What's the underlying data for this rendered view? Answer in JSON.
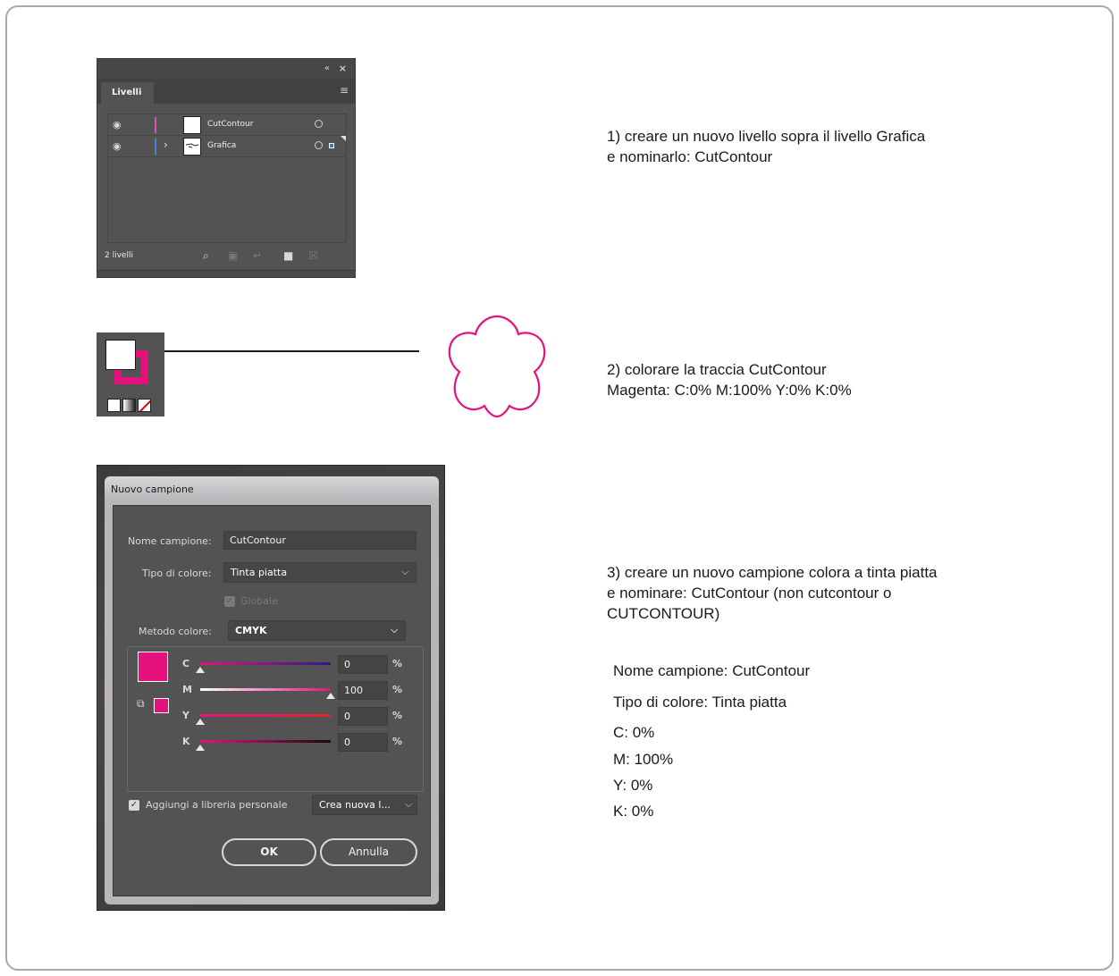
{
  "layers_panel": {
    "collapse_glyph": "«",
    "close_glyph": "×",
    "tab_label": "Livelli",
    "menu_glyph": "≡",
    "layers": [
      {
        "name": "CutContour",
        "color": "#d94fbf",
        "has_children": false,
        "selected": false
      },
      {
        "name": "Grafica",
        "color": "#4a7fd8",
        "has_children": true,
        "selected": true
      }
    ],
    "footer_count": "2 livelli",
    "footer_icons": [
      "search-icon",
      "clip-mask-icon",
      "new-sublayer-icon",
      "new-layer-icon",
      "delete-icon"
    ]
  },
  "fill_stroke": {
    "fill_color": "#ffffff",
    "stroke_color": "#e5127d",
    "modes": [
      "color",
      "gradient",
      "none"
    ]
  },
  "cut_shape": {
    "color": "#e5127d"
  },
  "dialog": {
    "title": "Nuovo campione",
    "name_label": "Nome campione:",
    "name_value": "CutContour",
    "type_label": "Tipo di colore:",
    "type_value": "Tinta piatta",
    "global_label": "Globale",
    "method_label": "Metodo colore:",
    "method_value": "CMYK",
    "swatch_color": "#e5127d",
    "sliders": [
      {
        "label": "C",
        "value": "0",
        "unit": "%",
        "level": 0
      },
      {
        "label": "M",
        "value": "100",
        "unit": "%",
        "level": 1
      },
      {
        "label": "Y",
        "value": "0",
        "unit": "%",
        "level": 0
      },
      {
        "label": "K",
        "value": "0",
        "unit": "%",
        "level": 0
      }
    ],
    "library_label": "Aggiungi a libreria personale",
    "library_value": "Crea nuova l...",
    "ok_label": "OK",
    "cancel_label": "Annulla"
  },
  "steps": {
    "step1": "1) creare un nuovo livello sopra il livello Grafica\ne nominarlo: CutContour",
    "step2": "2) colorare la traccia CutContour\nMagenta: C:0% M:100% Y:0% K:0%",
    "step3": "3) creare un nuovo campione colora a tinta piatta\ne nominare: CutContour (non cutcontour o\nCUTCONTOUR)",
    "summary_name": "Nome campione: CutContour",
    "summary_type": "Tipo di colore: Tinta piatta",
    "summary_c": "C: 0%",
    "summary_m": "M: 100%",
    "summary_y": "Y: 0%",
    "summary_k": "K: 0%"
  }
}
